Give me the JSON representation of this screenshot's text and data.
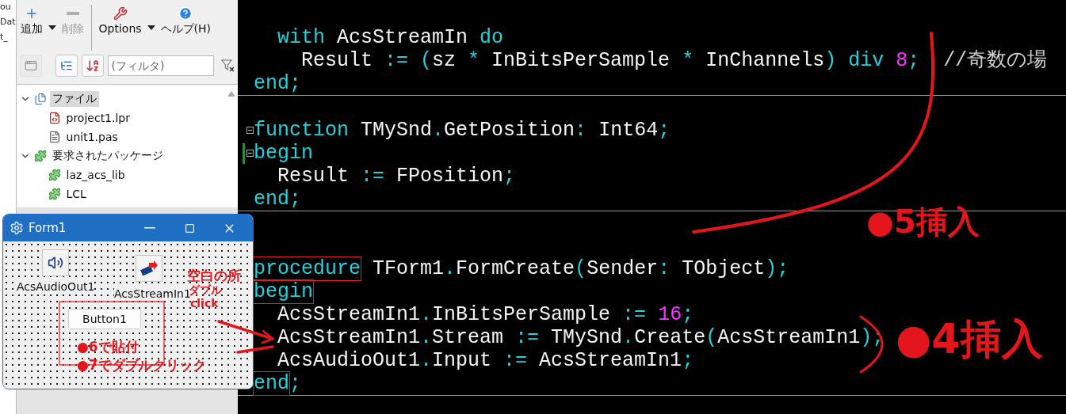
{
  "background_window": {
    "texts": [
      "ou",
      "Dat",
      "t_"
    ]
  },
  "package_panel": {
    "toolbar": [
      {
        "label": "追加",
        "kind": "add",
        "dropdown": true,
        "disabled": false,
        "separator_before": false
      },
      {
        "label": "削除",
        "kind": "remove",
        "dropdown": false,
        "disabled": true,
        "separator_before": false
      },
      {
        "label": "Options",
        "kind": "options",
        "dropdown": true,
        "disabled": false,
        "separator_before": true
      },
      {
        "label": "ヘルプ(H)",
        "kind": "help",
        "dropdown": false,
        "disabled": false,
        "separator_before": false
      }
    ],
    "filter_bar": {
      "buttons": [
        {
          "kind": "window",
          "disabled": true
        },
        {
          "kind": "tree",
          "disabled": false
        },
        {
          "kind": "sort",
          "disabled": false
        }
      ],
      "placeholder": "(フィルタ)"
    },
    "tree": [
      {
        "label": "ファイル",
        "kind": "files",
        "expanded": true,
        "selected": true,
        "children": [
          {
            "label": "project1.lpr",
            "kind": "project",
            "selected": false
          },
          {
            "label": "unit1.pas",
            "kind": "unit",
            "selected": false
          }
        ]
      },
      {
        "label": "要求されたパッケージ",
        "kind": "package",
        "expanded": true,
        "selected": false,
        "children": [
          {
            "label": "laz_acs_lib",
            "kind": "package",
            "selected": false
          },
          {
            "label": "LCL",
            "kind": "package",
            "selected": false
          }
        ]
      }
    ]
  },
  "form_window": {
    "title": "Form1",
    "components": [
      {
        "label": "AcsAudioOut1",
        "kind": "audio_out"
      },
      {
        "label": "AcsStreamIn1",
        "kind": "stream_in"
      }
    ],
    "button": "Button1"
  },
  "editor": {
    "blocks": [
      {
        "lines": [
          {
            "kind": "blank"
          },
          {
            "kind": "code",
            "fold": false,
            "modified": false,
            "tokens": [
              {
                "text": "  with",
                "kind": "keyword"
              },
              {
                "text": " AcsStreamIn ",
                "kind": "ident"
              },
              {
                "text": "do",
                "kind": "keyword"
              }
            ]
          },
          {
            "kind": "code",
            "fold": false,
            "modified": false,
            "tokens": [
              {
                "text": "    Result",
                "kind": "ident"
              },
              {
                "text": " := (",
                "kind": "symbol"
              },
              {
                "text": "sz",
                "kind": "ident"
              },
              {
                "text": " * ",
                "kind": "symbol"
              },
              {
                "text": "InBitsPerSample",
                "kind": "ident"
              },
              {
                "text": " * ",
                "kind": "symbol"
              },
              {
                "text": "InChannels",
                "kind": "ident"
              },
              {
                "text": ")",
                "kind": "symbol"
              },
              {
                "text": " div ",
                "kind": "keyword"
              },
              {
                "text": "8",
                "kind": "number"
              },
              {
                "text": ";",
                "kind": "symbol"
              },
              {
                "text": "  //奇数の場",
                "kind": "comment"
              }
            ]
          },
          {
            "kind": "code",
            "fold": false,
            "modified": false,
            "tokens": [
              {
                "text": "end",
                "kind": "keyword"
              },
              {
                "text": ";",
                "kind": "symbol"
              }
            ]
          }
        ]
      },
      {
        "lines": [
          {
            "kind": "blank"
          },
          {
            "kind": "code",
            "fold": true,
            "modified": false,
            "tokens": [
              {
                "text": "function",
                "kind": "keyword"
              },
              {
                "text": " TMySnd",
                "kind": "ident"
              },
              {
                "text": ".",
                "kind": "symbol"
              },
              {
                "text": "GetPosition",
                "kind": "ident"
              },
              {
                "text": ":",
                "kind": "symbol"
              },
              {
                "text": " Int64",
                "kind": "ident"
              },
              {
                "text": ";",
                "kind": "symbol"
              }
            ]
          },
          {
            "kind": "code",
            "fold": true,
            "modified": true,
            "tokens": [
              {
                "text": "begin",
                "kind": "keyword"
              }
            ]
          },
          {
            "kind": "code",
            "fold": false,
            "modified": false,
            "tokens": [
              {
                "text": "  Result",
                "kind": "ident"
              },
              {
                "text": " := ",
                "kind": "symbol"
              },
              {
                "text": "FPosition",
                "kind": "ident"
              },
              {
                "text": ";",
                "kind": "symbol"
              }
            ]
          },
          {
            "kind": "code",
            "fold": false,
            "modified": false,
            "tokens": [
              {
                "text": "end",
                "kind": "keyword"
              },
              {
                "text": ";",
                "kind": "symbol"
              }
            ]
          }
        ]
      },
      {
        "lines": [
          {
            "kind": "blank"
          },
          {
            "kind": "blank"
          },
          {
            "kind": "code",
            "fold": false,
            "modified": false,
            "tokens": [
              {
                "text": "procedure",
                "kind": "marked"
              },
              {
                "text": " TForm1",
                "kind": "ident"
              },
              {
                "text": ".",
                "kind": "symbol"
              },
              {
                "text": "FormCreate",
                "kind": "ident"
              },
              {
                "text": "(",
                "kind": "symbol"
              },
              {
                "text": "Sender",
                "kind": "ident"
              },
              {
                "text": ": ",
                "kind": "symbol"
              },
              {
                "text": "TObject",
                "kind": "ident"
              },
              {
                "text": ");",
                "kind": "symbol"
              }
            ]
          },
          {
            "kind": "code",
            "fold": false,
            "modified": false,
            "tokens": [
              {
                "text": "begin",
                "kind": "marked"
              }
            ]
          },
          {
            "kind": "code",
            "fold": false,
            "modified": false,
            "tokens": [
              {
                "text": "  AcsStreamIn1",
                "kind": "ident"
              },
              {
                "text": ".",
                "kind": "symbol"
              },
              {
                "text": "InBitsPerSample",
                "kind": "ident"
              },
              {
                "text": " := ",
                "kind": "symbol"
              },
              {
                "text": "16",
                "kind": "number"
              },
              {
                "text": ";",
                "kind": "symbol"
              }
            ]
          },
          {
            "kind": "code",
            "fold": false,
            "modified": false,
            "tokens": [
              {
                "text": "  AcsStreamIn1",
                "kind": "ident"
              },
              {
                "text": ".",
                "kind": "symbol"
              },
              {
                "text": "Stream",
                "kind": "ident"
              },
              {
                "text": " := ",
                "kind": "symbol"
              },
              {
                "text": "TMySnd",
                "kind": "ident"
              },
              {
                "text": ".",
                "kind": "symbol"
              },
              {
                "text": "Create",
                "kind": "ident"
              },
              {
                "text": "(",
                "kind": "symbol"
              },
              {
                "text": "AcsStreamIn1",
                "kind": "ident"
              },
              {
                "text": ");",
                "kind": "symbol"
              }
            ]
          },
          {
            "kind": "code",
            "fold": false,
            "modified": false,
            "tokens": [
              {
                "text": "  AcsAudioOut1",
                "kind": "ident"
              },
              {
                "text": ".",
                "kind": "symbol"
              },
              {
                "text": "Input",
                "kind": "ident"
              },
              {
                "text": " := ",
                "kind": "symbol"
              },
              {
                "text": "AcsStreamIn1",
                "kind": "ident"
              },
              {
                "text": ";",
                "kind": "symbol"
              }
            ]
          },
          {
            "kind": "code",
            "fold": false,
            "modified": false,
            "tokens": [
              {
                "text": "end",
                "kind": "marked"
              },
              {
                "text": ";",
                "kind": "symbol"
              }
            ]
          }
        ]
      }
    ]
  },
  "annotations": [
    {
      "text": "●5挿入",
      "kind": "big"
    },
    {
      "text": "●4挿入",
      "kind": "huge"
    },
    {
      "text": "空白の所",
      "kind": "small"
    },
    {
      "text": "ダブル",
      "kind": "tiny"
    },
    {
      "text": "click",
      "kind": "tiny"
    },
    {
      "text": "●6で貼付",
      "kind": "small"
    },
    {
      "text": "●7でダブルクリック",
      "kind": "small"
    }
  ]
}
